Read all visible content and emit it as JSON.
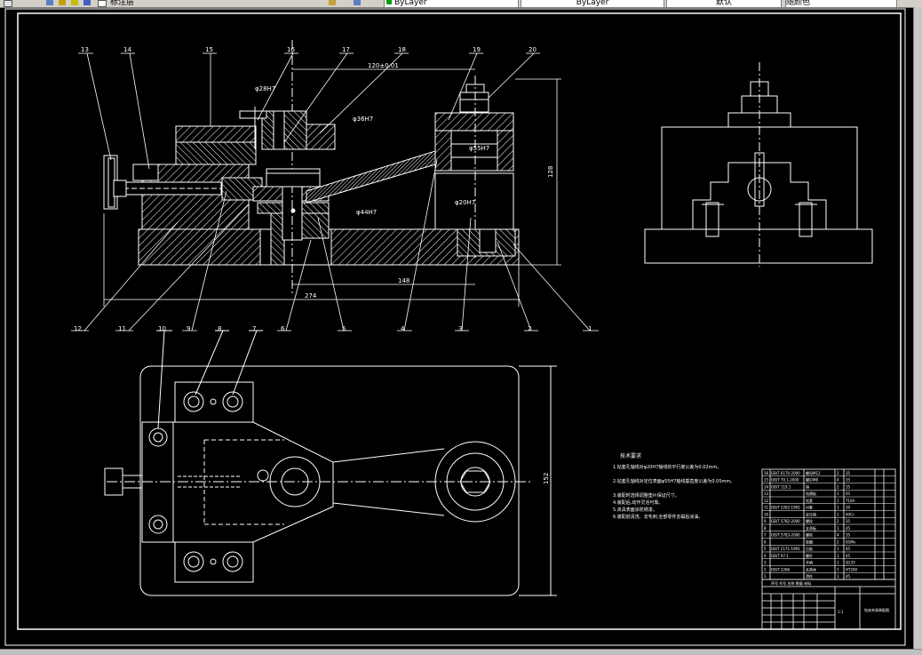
{
  "toolbar": {
    "segments": [
      {
        "text": ""
      },
      {
        "text": "标注层"
      },
      {
        "text": ""
      },
      {
        "text": "ByLayer"
      },
      {
        "text": "ByLayer"
      },
      {
        "text": "默认"
      },
      {
        "text": "随颜色"
      }
    ]
  },
  "colors": {
    "background": "#000000",
    "lines": "#ffffff",
    "toolbar": "#d4d0c8",
    "layer_swatch": "#00a000"
  },
  "balloons": {
    "top": [
      "13",
      "14",
      "15",
      "16",
      "17",
      "18",
      "19",
      "20"
    ],
    "bottom": [
      "12",
      "11",
      "9",
      "6",
      "5",
      "4",
      "3",
      "2",
      "1"
    ],
    "plan": [
      "10",
      "8",
      "7"
    ]
  },
  "dimensions": {
    "d120": "120±0.01",
    "d128": "128",
    "d148": "148",
    "d274": "274",
    "d152": "152",
    "phi28": "φ28H7",
    "phi36": "φ36H7",
    "phi55": "φ55H7",
    "phi20": "φ20H7",
    "phi44": "φ44H7"
  },
  "notes": {
    "title": "技术要求",
    "lines": [
      "1.钻套孔轴线对φ20H7轴线的平行度公差为0.02mm。",
      "2.钻套孔轴线对定位表面φ55H7轴线垂直度公差为0.05mm。",
      "3.装配时选择调整垫片保证尺寸。",
      "4.装配后,动作灵活可靠。",
      "5.夹具表面涂防锈漆。",
      "6.装配前清洗、去毛刺,全部零件去磁后涂油。"
    ]
  },
  "title_block": {
    "rows": [
      {
        "code": "GB/T 6170-2000",
        "name": "螺母M12",
        "qty": "2",
        "mat": "35"
      },
      {
        "code": "GB/T 70.1-2000",
        "name": "螺钉M8",
        "qty": "4",
        "mat": "35"
      },
      {
        "code": "GB/T 119.1",
        "name": "销",
        "qty": "2",
        "mat": "35"
      },
      {
        "code": "",
        "name": "钻模板",
        "qty": "1",
        "mat": "45"
      },
      {
        "code": "",
        "name": "钻套",
        "qty": "1",
        "mat": "T10A"
      },
      {
        "code": "GB/T 2262-1991",
        "name": "衬套",
        "qty": "1",
        "mat": "20"
      },
      {
        "code": "",
        "name": "定位销",
        "qty": "1",
        "mat": "40Cr"
      },
      {
        "code": "GB/T 5782-2000",
        "name": "螺栓",
        "qty": "2",
        "mat": "35"
      },
      {
        "code": "",
        "name": "支承板",
        "qty": "1",
        "mat": "45"
      },
      {
        "code": "GB/T 5783-2000",
        "name": "螺栓",
        "qty": "4",
        "mat": "35"
      },
      {
        "code": "",
        "name": "垫圈",
        "qty": "2",
        "mat": "65Mn"
      },
      {
        "code": "GB/T 2171-1991",
        "name": "压板",
        "qty": "1",
        "mat": "45"
      },
      {
        "code": "GB/T 97.1",
        "name": "螺杆",
        "qty": "1",
        "mat": "45"
      },
      {
        "code": "",
        "name": "手柄",
        "qty": "1",
        "mat": "Q235"
      },
      {
        "code": "GB/T 2266",
        "name": "夹具体",
        "qty": "1",
        "mat": "HT200"
      },
      {
        "code": "",
        "name": "滑柱",
        "qty": "1",
        "mat": "45"
      }
    ],
    "header": "序号 代号 名称 数量 材料",
    "drawing_name": "钻床夹具装配图",
    "scale": "1:1"
  }
}
